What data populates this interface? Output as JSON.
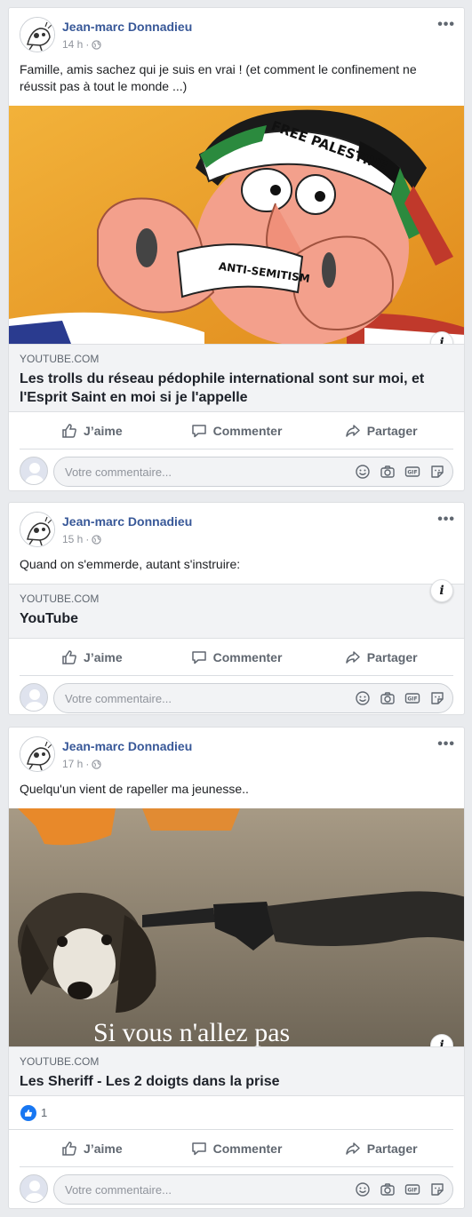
{
  "comment_placeholder": "Votre commentaire...",
  "actions": {
    "like": "J’aime",
    "comment": "Commenter",
    "share": "Partager"
  },
  "posts": [
    {
      "author": "Jean-marc Donnadieu",
      "time": "14 h",
      "separator": "·",
      "text": "Famille, amis sachez qui je suis en vrai ! (et comment le confinement ne réussit pas à tout le monde ...)",
      "image_text_1": "FREE PALESTINE",
      "image_text_2": "ANTI-SEMITISM",
      "link_domain": "YOUTUBE.COM",
      "link_title": "Les trolls du réseau pédophile international sont sur moi, et l'Esprit Saint en moi si je l'appelle"
    },
    {
      "author": "Jean-marc Donnadieu",
      "time": "15 h",
      "separator": "·",
      "text": "Quand on s'emmerde, autant s'instruire:",
      "link_domain": "YOUTUBE.COM",
      "link_title": "YouTube"
    },
    {
      "author": "Jean-marc Donnadieu",
      "time": "17 h",
      "separator": "·",
      "text": "Quelqu'un vient de rapeller ma jeunesse..",
      "image_caption": "Si vous n'allez pas",
      "link_domain": "YOUTUBE.COM",
      "link_title": "Les Sheriff - Les 2 doigts dans la prise",
      "like_count": "1"
    }
  ]
}
